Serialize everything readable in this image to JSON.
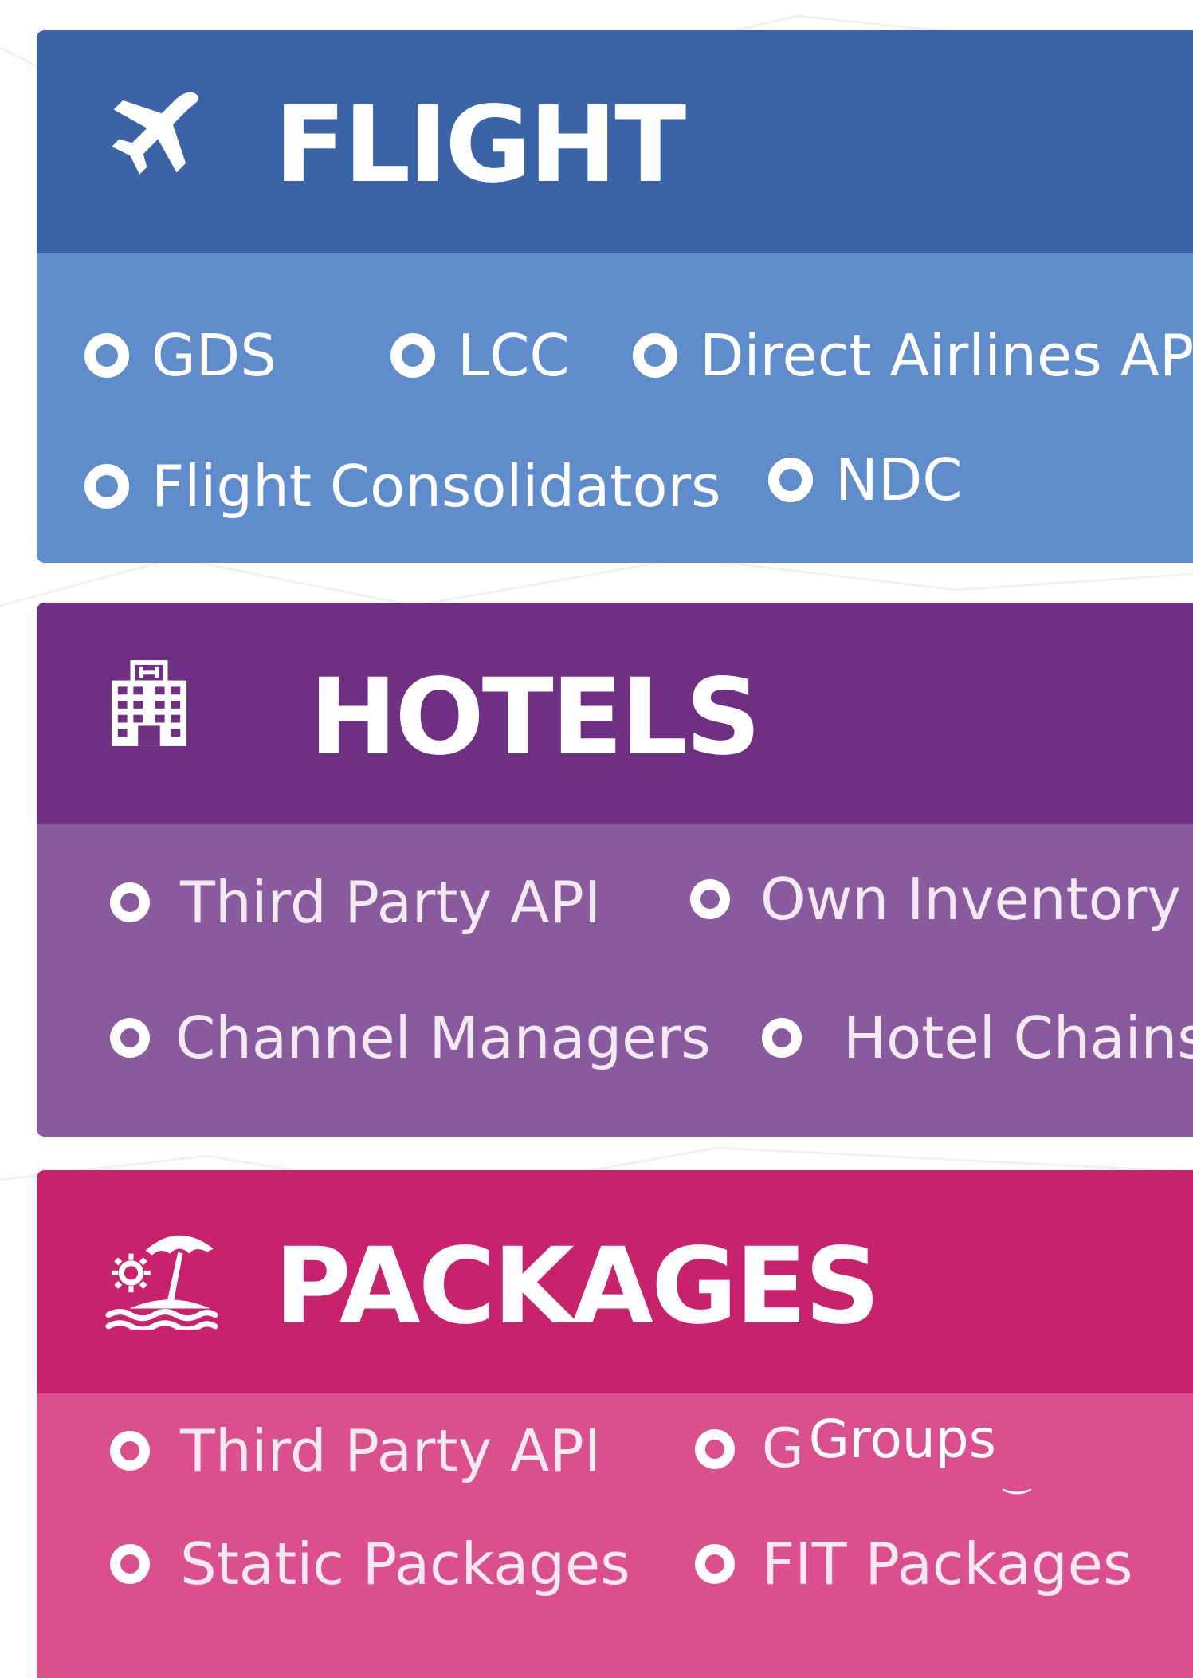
{
  "colors": {
    "flight_header": "#3a64a7",
    "flight_body": "#5f8cca",
    "hotels_header": "#6f2f82",
    "hotels_body": "#8a5a9f",
    "packages_header": "#c9226c",
    "packages_body": "#dc4f8e"
  },
  "flight": {
    "icon": "airplane-icon",
    "title": "FLIGHT",
    "items": [
      "GDS",
      "LCC",
      "Direct Airlines API",
      "Flight Consolidators",
      "NDC"
    ]
  },
  "hotels": {
    "icon": "hotel-building-icon",
    "title": "HOTELS",
    "items": [
      "Third Party API",
      "Own Inventory",
      "Channel Managers",
      "Hotel Chains"
    ]
  },
  "packages": {
    "icon": "beach-umbrella-icon",
    "title": "PACKAGES",
    "items": [
      "Third Party API",
      "G",
      "Groups",
      "Static Packages",
      "FIT Packages"
    ]
  }
}
